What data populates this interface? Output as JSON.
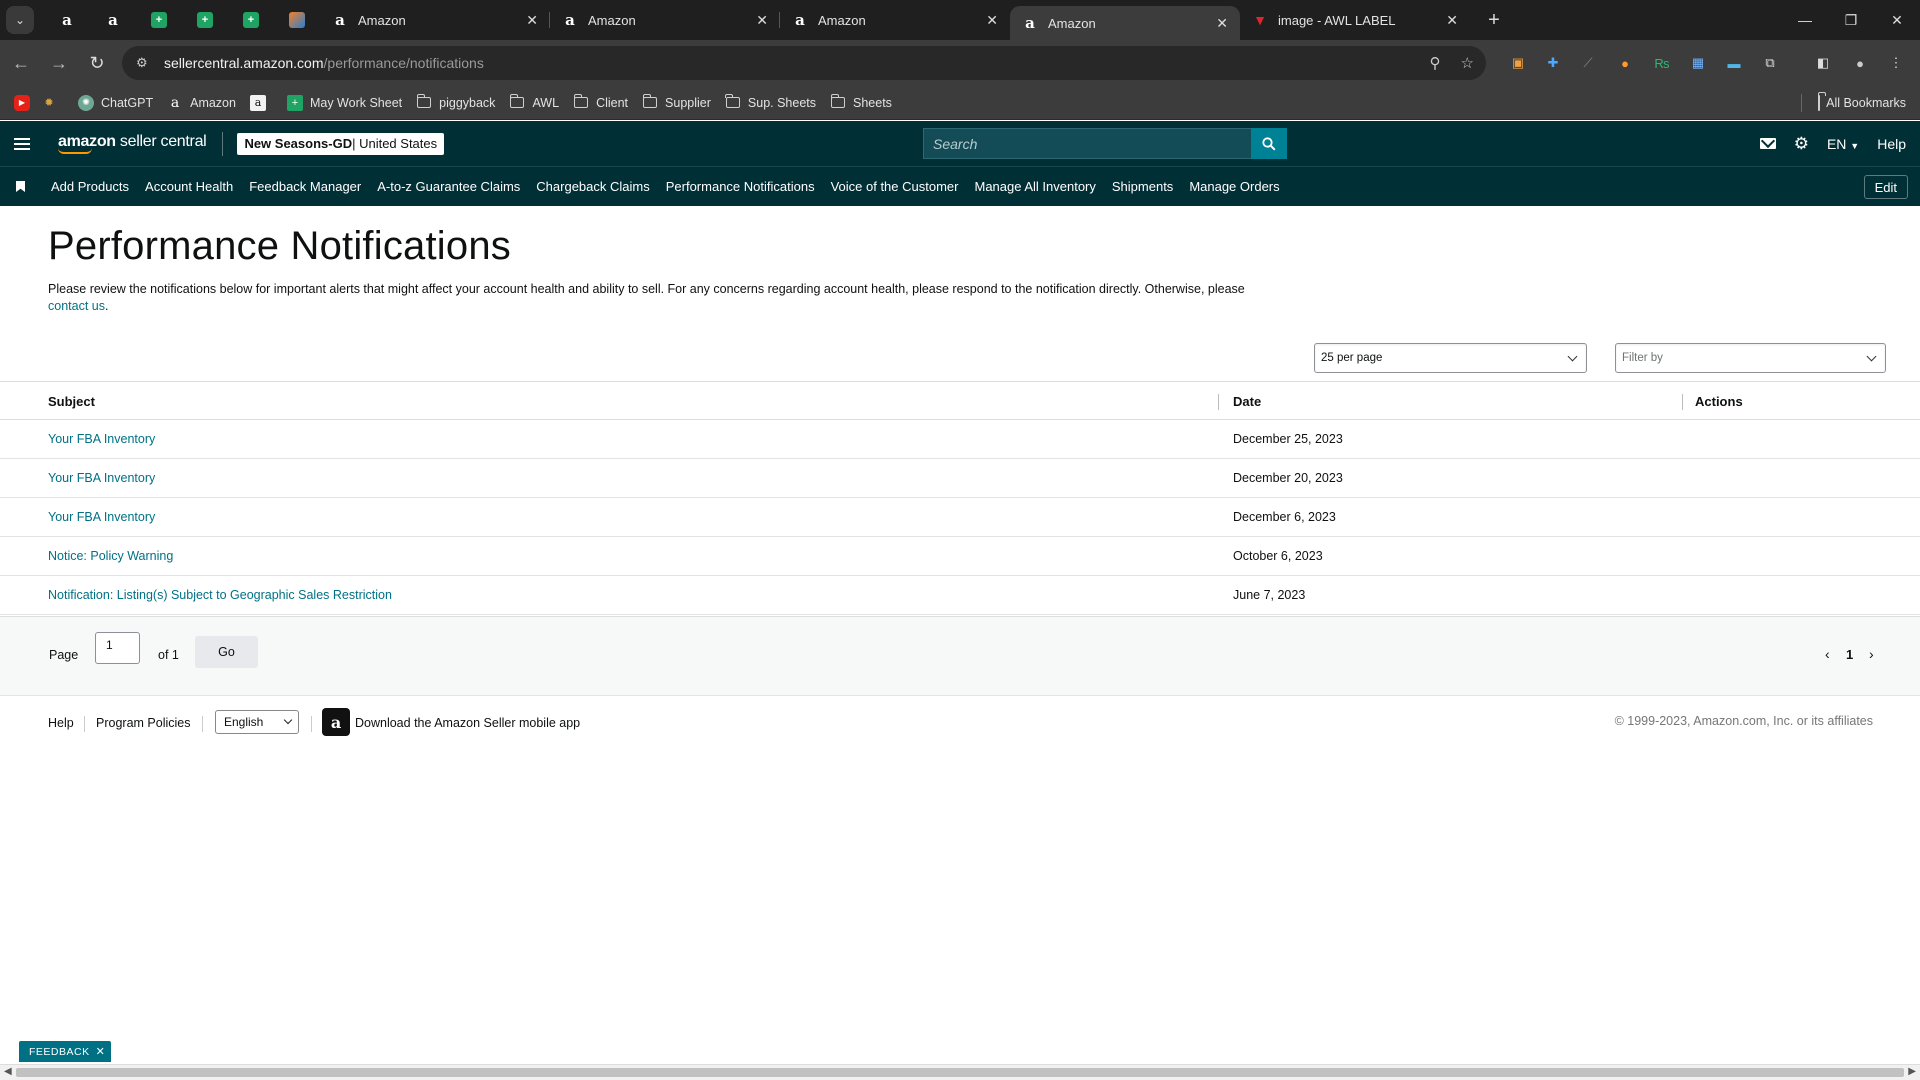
{
  "browser": {
    "tabs": [
      {
        "title": "Amazon",
        "icon": "amazon-icon"
      },
      {
        "title": "Amazon",
        "icon": "amazon-icon"
      },
      {
        "title": "Amazon",
        "icon": "amazon-icon"
      },
      {
        "title": "Amazon",
        "icon": "amazon-icon",
        "active": true
      },
      {
        "title": "image - AWL LABEL",
        "icon": "awl-icon"
      }
    ],
    "url_host": "sellercentral.amazon.com",
    "url_path": "/performance/notifications"
  },
  "bookmarks": {
    "items": [
      {
        "label": "ChatGPT",
        "icon": "chatgpt-icon"
      },
      {
        "label": "Amazon",
        "icon": "amazon-icon"
      },
      {
        "label": "May Work Sheet",
        "icon": "sheets-icon"
      },
      {
        "label": "piggyback",
        "icon": "folder-icon"
      },
      {
        "label": "AWL",
        "icon": "folder-icon"
      },
      {
        "label": "Client",
        "icon": "folder-icon"
      },
      {
        "label": "Supplier",
        "icon": "folder-icon"
      },
      {
        "label": "Sup. Sheets",
        "icon": "folder-icon"
      },
      {
        "label": "Sheets",
        "icon": "folder-icon"
      }
    ],
    "all_bookmarks": "All Bookmarks"
  },
  "header": {
    "logo_bold": "amazon",
    "logo_rest": " seller central",
    "store_name": "New Seasons-GD",
    "store_region": " | United States",
    "search_placeholder": "Search",
    "language": "EN",
    "help": "Help"
  },
  "subnav": {
    "items": [
      "Add Products",
      "Account Health",
      "Feedback Manager",
      "A-to-z Guarantee Claims",
      "Chargeback Claims",
      "Performance Notifications",
      "Voice of the Customer",
      "Manage All Inventory",
      "Shipments",
      "Manage Orders"
    ],
    "edit": "Edit"
  },
  "page": {
    "title": "Performance Notifications",
    "description": "Please review the notifications below for important alerts that might affect your account health and ability to sell. For any concerns regarding account health, please respond to the notification directly. Otherwise, please",
    "contact_link": "contact us",
    "per_page": "25 per page",
    "filter_placeholder": "Filter by"
  },
  "table": {
    "headers": {
      "subject": "Subject",
      "date": "Date",
      "actions": "Actions"
    },
    "rows": [
      {
        "subject": "Your FBA Inventory",
        "date": "December 25, 2023"
      },
      {
        "subject": "Your FBA Inventory",
        "date": "December 20, 2023"
      },
      {
        "subject": "Your FBA Inventory",
        "date": "December 6, 2023"
      },
      {
        "subject": "Notice: Policy Warning",
        "date": "October 6, 2023"
      },
      {
        "subject": "Notification: Listing(s) Subject to Geographic Sales Restriction",
        "date": "June 7, 2023"
      }
    ]
  },
  "pager": {
    "page_label": "Page",
    "page_value": "1",
    "of_label": "of 1",
    "go": "Go",
    "current": "1"
  },
  "footer": {
    "help": "Help",
    "program_policies": "Program Policies",
    "language": "English",
    "app_text": "Download the Amazon Seller mobile app",
    "copyright": "© 1999-2023, Amazon.com, Inc. or its affiliates"
  },
  "feedback": "FEEDBACK",
  "colors": {
    "header_bg": "#002f36",
    "link": "#007185",
    "search_button": "#008296",
    "accent": "#ff9900"
  }
}
